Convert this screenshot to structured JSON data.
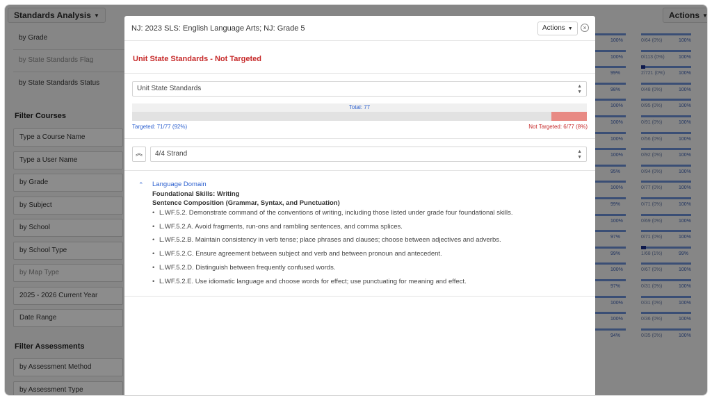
{
  "app": {
    "title": "Standards Analysis",
    "actions_label": "Actions"
  },
  "sidebar": {
    "items_top": [
      {
        "label": "by Grade",
        "muted": false
      },
      {
        "label": "by State Standards Flag",
        "muted": true
      },
      {
        "label": "by State Standards Status",
        "muted": false
      }
    ],
    "filter_courses_heading": "Filter Courses",
    "course_filters": [
      {
        "label": "Type a Course Name",
        "muted": false
      },
      {
        "label": "Type a User Name",
        "muted": false
      },
      {
        "label": "by Grade",
        "muted": false
      },
      {
        "label": "by Subject",
        "muted": false
      },
      {
        "label": "by School",
        "muted": false
      },
      {
        "label": "by School Type",
        "muted": false
      },
      {
        "label": "by Map Type",
        "muted": true
      },
      {
        "label": "2025 - 2026  Current Year",
        "muted": false
      },
      {
        "label": "Date Range",
        "muted": false
      }
    ],
    "filter_assessments_heading": "Filter Assessments",
    "assessment_filters": [
      {
        "label": "by Assessment Method",
        "muted": false
      },
      {
        "label": "by Assessment Type",
        "muted": false
      }
    ]
  },
  "right_rows": [
    {
      "pct1": "100%",
      "frac": "0/64 (0%)",
      "pct2": "100%",
      "fill": 0
    },
    {
      "pct1": "100%",
      "frac": "0/113 (0%)",
      "pct2": "100%",
      "fill": 0
    },
    {
      "pct1": "99%",
      "frac": "2/721 (0%)",
      "pct2": "100%",
      "fill": 0.08
    },
    {
      "pct1": "98%",
      "frac": "0/48 (0%)",
      "pct2": "100%",
      "fill": 0
    },
    {
      "pct1": "100%",
      "frac": "0/95 (0%)",
      "pct2": "100%",
      "fill": 0
    },
    {
      "pct1": "100%",
      "frac": "0/91 (0%)",
      "pct2": "100%",
      "fill": 0
    },
    {
      "pct1": "100%",
      "frac": "0/56 (0%)",
      "pct2": "100%",
      "fill": 0
    },
    {
      "pct1": "100%",
      "frac": "0/92 (0%)",
      "pct2": "100%",
      "fill": 0
    },
    {
      "pct1": "95%",
      "frac": "0/94 (0%)",
      "pct2": "100%",
      "fill": 0
    },
    {
      "pct1": "100%",
      "frac": "0/77 (0%)",
      "pct2": "100%",
      "fill": 0
    },
    {
      "pct1": "99%",
      "frac": "0/71 (0%)",
      "pct2": "100%",
      "fill": 0
    },
    {
      "pct1": "100%",
      "frac": "0/69 (0%)",
      "pct2": "100%",
      "fill": 0
    },
    {
      "pct1": "97%",
      "frac": "0/71 (0%)",
      "pct2": "100%",
      "fill": 0
    },
    {
      "pct1": "99%",
      "frac": "1/68 (1%)",
      "pct2": "99%",
      "fill": 0.1
    },
    {
      "pct1": "100%",
      "frac": "0/67 (0%)",
      "pct2": "100%",
      "fill": 0
    },
    {
      "pct1": "97%",
      "frac": "0/31 (0%)",
      "pct2": "100%",
      "fill": 0
    },
    {
      "pct1": "100%",
      "frac": "0/31 (0%)",
      "pct2": "100%",
      "fill": 0
    },
    {
      "pct1": "100%",
      "frac": "0/36 (0%)",
      "pct2": "100%",
      "fill": 0
    },
    {
      "pct1": "94%",
      "frac": "0/35 (0%)",
      "pct2": "100%",
      "fill": 0
    }
  ],
  "modal": {
    "title": "NJ: 2023 SLS: English Language Arts; NJ: Grade 5",
    "actions_label": "Actions",
    "subtitle": "Unit State Standards - Not Targeted",
    "unit_select_value": "Unit State Standards",
    "total_label": "Total: 77",
    "targeted_label": "Targeted: 71/77 (92%)",
    "not_targeted_label": "Not Targeted: 6/77 (8%)",
    "not_targeted_fraction": 0.0779,
    "strand_select_value": "4/4 Strand",
    "domain": "Language Domain",
    "category1": "Foundational Skills: Writing",
    "category2": "Sentence Composition (Grammar, Syntax, and Punctuation)",
    "standards": [
      "L.WF.5.2. Demonstrate command of the conventions of writing, including those listed under grade four foundational skills.",
      "L.WF.5.2.A. Avoid fragments, run-ons and rambling sentences, and comma splices.",
      "L.WF.5.2.B. Maintain consistency in verb tense; place phrases and clauses; choose between adjectives and adverbs.",
      "L.WF.5.2.C. Ensure agreement between subject and verb and between pronoun and antecedent.",
      "L.WF.5.2.D. Distinguish between frequently confused words.",
      "L.WF.5.2.E. Use idiomatic language and choose words for effect; use punctuating for meaning and effect."
    ]
  },
  "colors": {
    "accent_blue": "#2b5fcf",
    "alert_red": "#c62828",
    "not_targeted_fill": "#e88a84"
  }
}
